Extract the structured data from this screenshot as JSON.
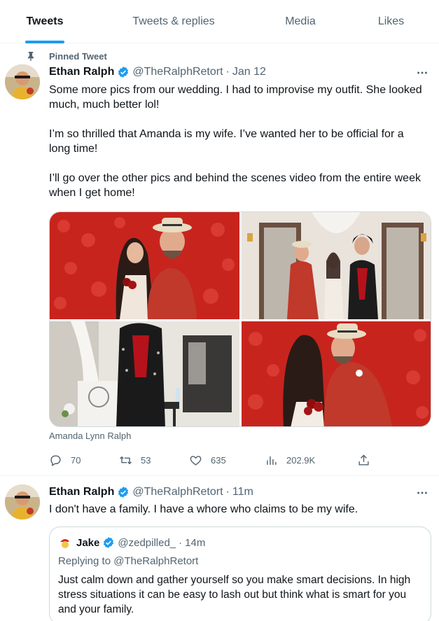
{
  "tabs": [
    {
      "label": "Tweets",
      "active": true
    },
    {
      "label": "Tweets & replies",
      "active": false
    },
    {
      "label": "Media",
      "active": false
    },
    {
      "label": "Likes",
      "active": false
    }
  ],
  "colors": {
    "accent": "#1d9bf0",
    "text": "#0f1419",
    "secondary": "#536471",
    "border": "#cfd9de"
  },
  "tweets": [
    {
      "pinned_label": "Pinned Tweet",
      "name": "Ethan Ralph",
      "handle": "@TheRalphRetort",
      "dot": "·",
      "time": "Jan 12",
      "paragraphs": [
        "Some more pics from our wedding. I had to improvise my outfit. She looked much, much better lol!",
        "I’m so thrilled that Amanda is my wife. I’ve wanted her to be official for a long time!",
        "I’ll go over the other pics and behind the scenes video from the entire week when I get home!"
      ],
      "media_tag": "Amanda Lynn Ralph",
      "stats": {
        "replies": "70",
        "retweets": "53",
        "likes": "635",
        "views": "202.9K"
      }
    },
    {
      "name": "Ethan Ralph",
      "handle": "@TheRalphRetort",
      "dot": "·",
      "time": "11m",
      "text": "I don't have a family. I have a whore who claims to be my wife.",
      "quote": {
        "name": "Jake",
        "handle": "@zedpilled_",
        "dot": "·",
        "time": "14m",
        "replying_prefix": "Replying to",
        "replying_to": "@TheRalphRetort",
        "text": "Just calm down and gather yourself so you make smart decisions. In high stress situations it can be easy to lash out but think what is smart for you and your family."
      }
    }
  ]
}
